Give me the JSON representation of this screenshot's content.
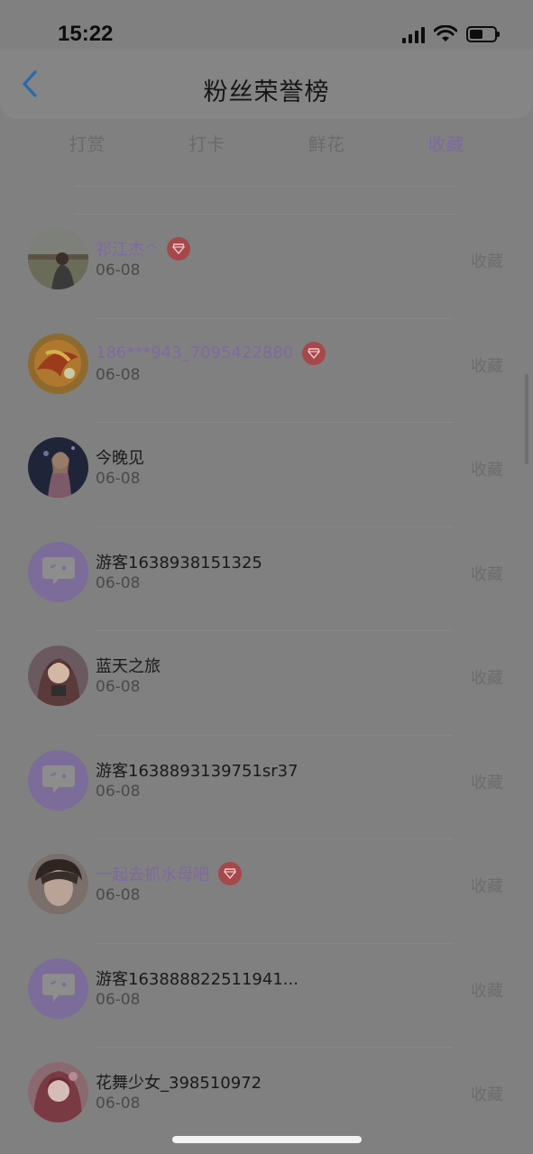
{
  "status": {
    "time": "15:22"
  },
  "header": {
    "title": "粉丝荣誉榜"
  },
  "tabs": [
    {
      "label": "打赏",
      "active": false
    },
    {
      "label": "打卡",
      "active": false
    },
    {
      "label": "鲜花",
      "active": false
    },
    {
      "label": "收藏",
      "active": true
    }
  ],
  "colors": {
    "accent": "#7f6a9c",
    "badge": "#a5484c",
    "guest_avatar": "#7c6c99"
  },
  "fans": [
    {
      "name": "祁江杰^",
      "date": "06-08",
      "action": "收藏",
      "vip": true,
      "avatar": "photo-man-outdoor"
    },
    {
      "name": "186***943_7095422880",
      "date": "06-08",
      "action": "收藏",
      "vip": true,
      "avatar": "phoenix-art"
    },
    {
      "name": "今晚见",
      "date": "06-08",
      "action": "收藏",
      "vip": false,
      "avatar": "anime-character"
    },
    {
      "name": "游客1638938151325",
      "date": "06-08",
      "action": "收藏",
      "vip": false,
      "avatar": "guest-chat-icon"
    },
    {
      "name": "蓝天之旅",
      "date": "06-08",
      "action": "收藏",
      "vip": false,
      "avatar": "anime-girl"
    },
    {
      "name": "游客1638893139751sr37",
      "date": "06-08",
      "action": "收藏",
      "vip": false,
      "avatar": "guest-chat-icon"
    },
    {
      "name": "一起去抓水母吧",
      "date": "06-08",
      "action": "收藏",
      "vip": true,
      "avatar": "photo-boy"
    },
    {
      "name": "游客163888822511941...",
      "date": "06-08",
      "action": "收藏",
      "vip": false,
      "avatar": "guest-chat-icon"
    },
    {
      "name": "花舞少女_398510972",
      "date": "06-08",
      "action": "收藏",
      "vip": false,
      "avatar": "anime-girl-pink"
    }
  ]
}
